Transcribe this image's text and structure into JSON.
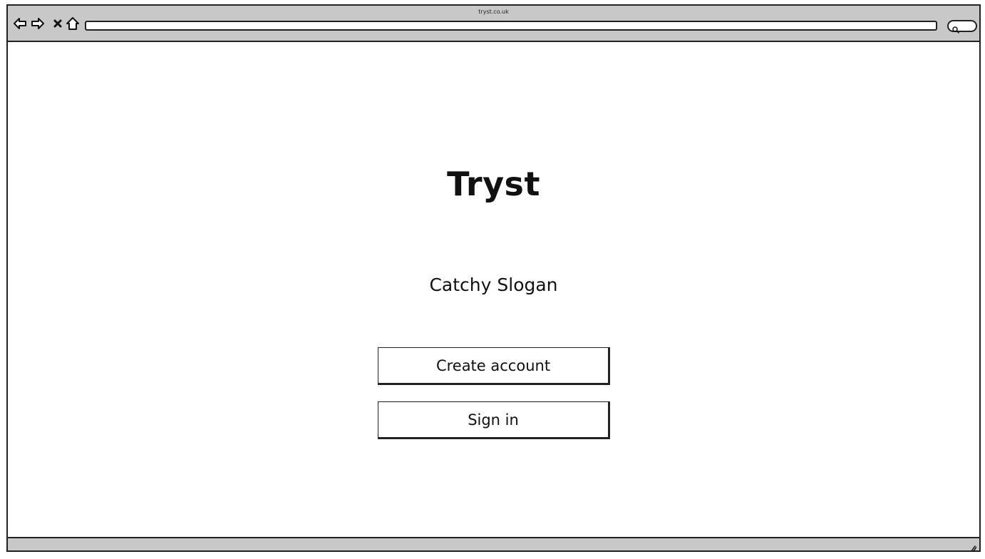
{
  "window": {
    "title": "tryst.co.uk"
  },
  "toolbar": {
    "icons": [
      "back-arrow-icon",
      "forward-arrow-icon",
      "close-icon",
      "home-icon",
      "search-icon"
    ],
    "address_value": ""
  },
  "main": {
    "app_title": "Tryst",
    "slogan": "Catchy Slogan",
    "create_account_label": "Create account",
    "sign_in_label": "Sign in"
  },
  "colors": {
    "chrome": "#c8c8c8",
    "stroke": "#222222",
    "background": "#ffffff"
  }
}
